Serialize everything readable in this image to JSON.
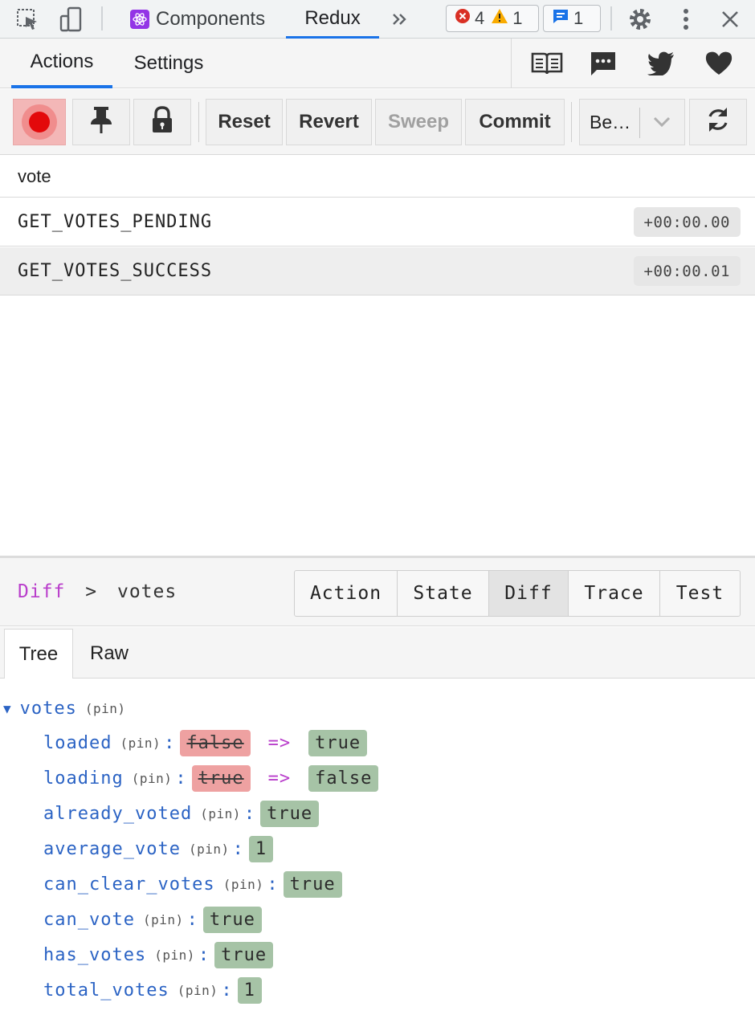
{
  "devtools": {
    "tabs": [
      {
        "label": "Components"
      },
      {
        "label": "Redux"
      }
    ],
    "badges": {
      "errors": "4",
      "warnings": "1",
      "messages": "1"
    }
  },
  "monitor": {
    "tabs": {
      "actions": "Actions",
      "settings": "Settings"
    }
  },
  "toolbar": {
    "reset": "Reset",
    "revert": "Revert",
    "sweep": "Sweep",
    "commit": "Commit",
    "select_value": "Be…"
  },
  "filter": {
    "value": "vote"
  },
  "actions": [
    {
      "type": "GET_VOTES_PENDING",
      "time": "+00:00.00"
    },
    {
      "type": "GET_VOTES_SUCCESS",
      "time": "+00:00.01"
    }
  ],
  "inspector": {
    "breadcrumb": {
      "root": "Diff",
      "sep": ">",
      "path": "votes"
    },
    "tabs": {
      "action": "Action",
      "state": "State",
      "diff": "Diff",
      "trace": "Trace",
      "test": "Test"
    },
    "subtabs": {
      "tree": "Tree",
      "raw": "Raw"
    }
  },
  "tree": {
    "root_key": "votes",
    "pin_label": "(pin)",
    "arrow_sym": "=>",
    "rows": [
      {
        "key": "loaded",
        "old": "false",
        "new": "true"
      },
      {
        "key": "loading",
        "old": "true",
        "new": "false"
      },
      {
        "key": "already_voted",
        "new": "true"
      },
      {
        "key": "average_vote",
        "new": "1"
      },
      {
        "key": "can_clear_votes",
        "new": "true"
      },
      {
        "key": "can_vote",
        "new": "true"
      },
      {
        "key": "has_votes",
        "new": "true"
      },
      {
        "key": "total_votes",
        "new": "1"
      }
    ]
  }
}
